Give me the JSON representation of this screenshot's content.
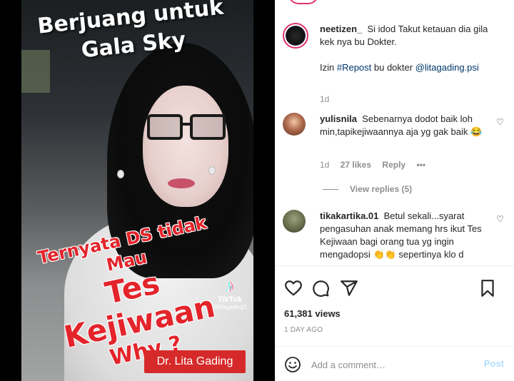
{
  "video": {
    "caption_top_line1": "Berjuang untuk",
    "caption_top_line2": "Gala Sky",
    "caption_red_line1": "Ternyata DS tidak Mau",
    "caption_red_line2": "Tes Kejiwaan",
    "caption_red_line3": "Why ?",
    "watermark_name": "TikTok",
    "watermark_handle": "@litagading2",
    "badge": "Dr. Lita Gading"
  },
  "comments": [
    {
      "username": "neetizen_",
      "text": "Si idod Takut ketauan dia gila kek nya bu Dokter.",
      "text2_prefix": "Izin ",
      "hashtag": "#Repost",
      "text2_mid": " bu dokter ",
      "mention": "@litagading.psi",
      "age": "1d"
    },
    {
      "username": "yulisnila",
      "text": "Sebenarnya dodot baik loh min,tapikejiwaannya aja yg gak baik 😂",
      "age": "1d",
      "likes": "27 likes",
      "reply": "Reply",
      "more": "•••",
      "view_replies": "View replies (5)"
    },
    {
      "username": "tikakartika.01",
      "text": "Betul sekali...syarat pengasuhan anak memang hrs ikut Tes Kejiwaan bagi orang tua yg ingin mengadopsi 👏👏 sepertinya klo d"
    }
  ],
  "actions": {
    "views": "61,381 views",
    "posted": "1 DAY AGO"
  },
  "comment_box": {
    "placeholder": "Add a comment…",
    "post_label": "Post"
  },
  "colors": {
    "link": "#00376b",
    "muted": "#8e8e8e",
    "post_disabled": "#b2dffc",
    "story_ring": "#e1306c",
    "badge_red": "#d62a2a"
  }
}
